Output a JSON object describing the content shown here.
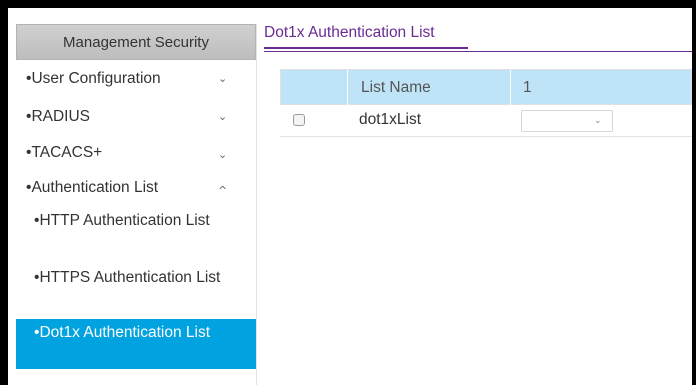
{
  "sidebar": {
    "header": "Management Security",
    "items": [
      {
        "label": "User Configuration",
        "chevron": "⌄"
      },
      {
        "label": "RADIUS",
        "chevron": "⌄"
      },
      {
        "label": "TACACS+",
        "chevron": "⌄"
      },
      {
        "label": "Authentication List",
        "chevron": "^"
      }
    ],
    "subitems": [
      {
        "label": "HTTP Authentication List"
      },
      {
        "label": "HTTPS Authentication List"
      },
      {
        "label": "Dot1x Authentication List"
      }
    ],
    "active_color": "#00a2e0"
  },
  "main": {
    "tab_title": "Dot1x Authentication List",
    "accent_color": "#6b2c91",
    "table": {
      "header": {
        "list_name": "List Name",
        "col1": "1"
      },
      "rows": [
        {
          "name": "dot1xList",
          "select_value": "",
          "select_arrow": "⌄"
        }
      ]
    }
  },
  "icons": {
    "bullet": "•",
    "checkbox": "checkbox-icon"
  }
}
